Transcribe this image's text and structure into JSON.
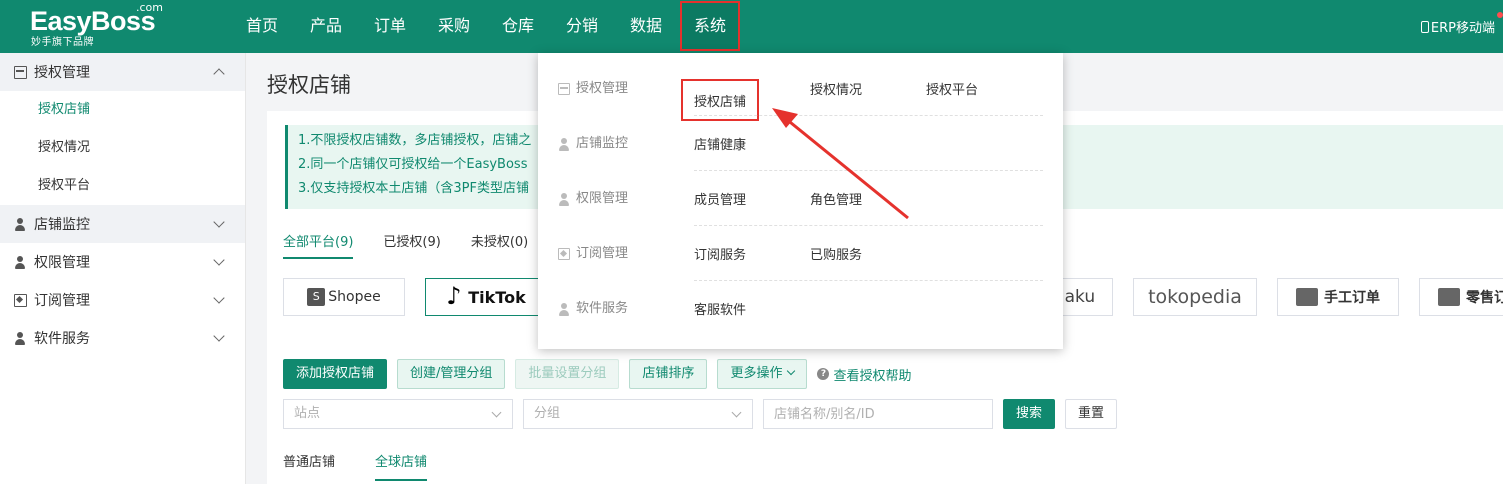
{
  "app": {
    "logo_main": "EasyBoss",
    "logo_com": ".com",
    "logo_sub": "妙手旗下品牌",
    "erp_mobile": "ERP移动端"
  },
  "nav": [
    "首页",
    "产品",
    "订单",
    "采购",
    "仓库",
    "分销",
    "数据",
    "系统"
  ],
  "nav_active": "系统",
  "sidebar": {
    "groups": [
      {
        "label": "授权管理",
        "icon": "store-icon",
        "open": true,
        "items": [
          "授权店铺",
          "授权情况",
          "授权平台"
        ],
        "active": "授权店铺"
      },
      {
        "label": "店铺监控",
        "icon": "person-icon",
        "open": false
      },
      {
        "label": "权限管理",
        "icon": "person-icon",
        "open": false
      },
      {
        "label": "订阅管理",
        "icon": "bookmark-icon",
        "open": false
      },
      {
        "label": "软件服务",
        "icon": "person-icon",
        "open": false
      }
    ]
  },
  "main": {
    "title": "授权店铺",
    "notice": [
      "1.不限授权店铺数，多店铺授权，店铺之",
      "2.同一个店铺仅可授权给一个EasyBoss",
      "3.仅支持授权本土店铺（含3PF类型店铺"
    ],
    "platform_tabs": [
      {
        "label": "全部平台(9)",
        "active": true
      },
      {
        "label": "已授权(9)",
        "active": false
      },
      {
        "label": "未授权(0)",
        "active": false
      }
    ],
    "platforms": {
      "shopee": "Shopee",
      "tiktok": "TikTok",
      "lazada_partial": "laku",
      "tokopedia": "tokopedia",
      "manual": "手工订单",
      "retail_partial": "零售订"
    },
    "buttons": {
      "add": "添加授权店铺",
      "group_manage": "创建/管理分组",
      "batch_group": "批量设置分组",
      "sort": "店铺排序",
      "more": "更多操作",
      "help": "查看授权帮助",
      "search": "搜索",
      "reset": "重置"
    },
    "filters": {
      "site_placeholder": "站点",
      "group_placeholder": "分组",
      "name_placeholder": "店铺名称/别名/ID"
    },
    "store_tabs": [
      {
        "label": "普通店铺",
        "active": false
      },
      {
        "label": "全球店铺",
        "active": true
      }
    ]
  },
  "dropdown": {
    "rows": [
      {
        "category": "授权管理",
        "icon": "store-icon",
        "links": [
          "授权店铺",
          "授权情况",
          "授权平台"
        ],
        "highlight": "授权店铺"
      },
      {
        "category": "店铺监控",
        "icon": "person-icon",
        "links": [
          "店铺健康"
        ]
      },
      {
        "category": "权限管理",
        "icon": "person-icon",
        "links": [
          "成员管理",
          "角色管理"
        ]
      },
      {
        "category": "订阅管理",
        "icon": "bookmark-icon",
        "links": [
          "订阅服务",
          "已购服务"
        ]
      },
      {
        "category": "软件服务",
        "icon": "person-icon",
        "links": [
          "客服软件"
        ]
      }
    ]
  },
  "colors": {
    "brand": "#10896f",
    "highlight": "#e5322d"
  }
}
